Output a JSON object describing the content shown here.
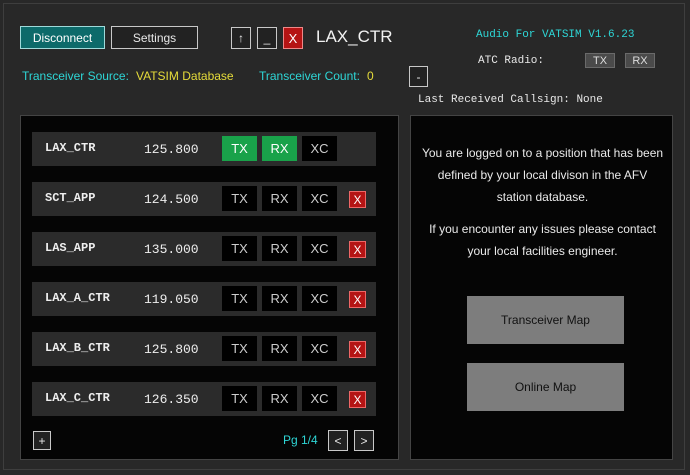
{
  "header": {
    "disconnect_label": "Disconnect",
    "settings_label": "Settings",
    "up_label": "↑",
    "minimize_label": "_",
    "close_label": "X",
    "title": "LAX_CTR",
    "audio_version": "Audio For VATSIM V1.6.23",
    "atc_radio_label": "ATC Radio:",
    "atc_tx": "TX",
    "atc_rx": "RX"
  },
  "status": {
    "source_label": "Transceiver Source:",
    "source_value": "VATSIM Database",
    "count_label": "Transceiver Count:",
    "count_value": "0",
    "minus_label": "-",
    "last_received_label": "Last Received Callsign:",
    "last_received_value": "None"
  },
  "stations": [
    {
      "callsign": "LAX_CTR",
      "frequency": "125.800",
      "tx": "TX",
      "rx": "RX",
      "xc": "XC",
      "tx_on": true,
      "rx_on": true,
      "removable": false
    },
    {
      "callsign": "SCT_APP",
      "frequency": "124.500",
      "tx": "TX",
      "rx": "RX",
      "xc": "XC",
      "tx_on": false,
      "rx_on": false,
      "removable": true
    },
    {
      "callsign": "LAS_APP",
      "frequency": "135.000",
      "tx": "TX",
      "rx": "RX",
      "xc": "XC",
      "tx_on": false,
      "rx_on": false,
      "removable": true
    },
    {
      "callsign": "LAX_A_CTR",
      "frequency": "119.050",
      "tx": "TX",
      "rx": "RX",
      "xc": "XC",
      "tx_on": false,
      "rx_on": false,
      "removable": true
    },
    {
      "callsign": "LAX_B_CTR",
      "frequency": "125.800",
      "tx": "TX",
      "rx": "RX",
      "xc": "XC",
      "tx_on": false,
      "rx_on": false,
      "removable": true
    },
    {
      "callsign": "LAX_C_CTR",
      "frequency": "126.350",
      "tx": "TX",
      "rx": "RX",
      "xc": "XC",
      "tx_on": false,
      "rx_on": false,
      "removable": true
    }
  ],
  "station_delete_label": "X",
  "pager": {
    "add_label": "+",
    "page_label": "Pg 1/4",
    "prev_label": "<",
    "next_label": ">"
  },
  "info_panel": {
    "message1": "You are logged on to a position that has been defined by your local divison in the AFV station database.",
    "message2": "If you encounter any issues please contact your local facilities engineer.",
    "transceiver_map_label": "Transceiver Map",
    "online_map_label": "Online Map"
  },
  "colors": {
    "background": "#282828",
    "accent_cyan": "#2ed6d6",
    "accent_yellow": "#e6dc3a",
    "active_green": "#19a24a",
    "danger_red": "#b51414",
    "disconnect_teal": "#0d6a6a"
  }
}
